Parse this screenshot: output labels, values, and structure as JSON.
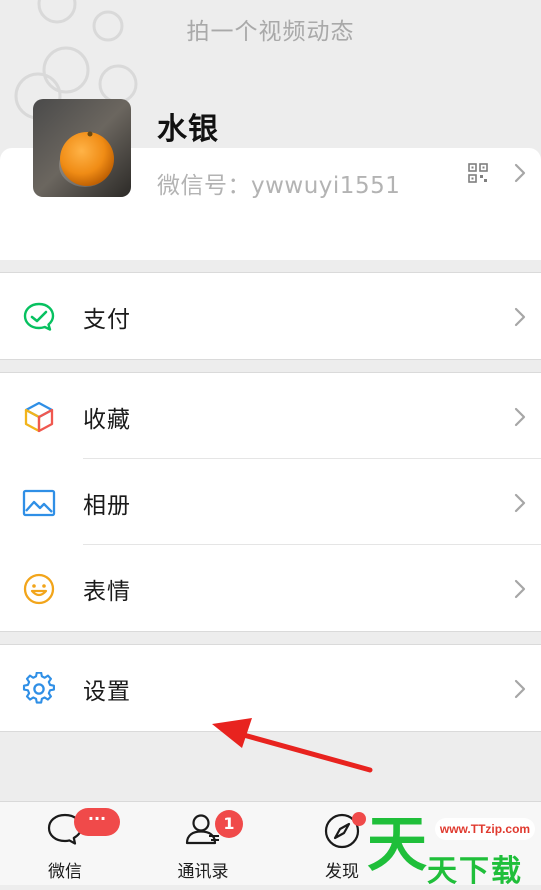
{
  "header": {
    "moments_hint": "拍一个视频动态"
  },
  "profile": {
    "nickname": "水银",
    "wechat_id": "微信号：ywwuyi1551"
  },
  "menu": {
    "pay": "支付",
    "favorites": "收藏",
    "album": "相册",
    "stickers": "表情",
    "settings": "设置"
  },
  "tabbar": {
    "chats": "微信",
    "contacts": "通讯录",
    "discover": "发现",
    "chats_badge": "···",
    "contacts_badge": "1"
  },
  "watermark": {
    "url": "www.TTzip.com",
    "brand_big": "天",
    "brand_small": "天下载"
  },
  "colors": {
    "wechat_green": "#07c160",
    "badge_red": "#f04a4a",
    "arrow_red": "#e8231f"
  }
}
